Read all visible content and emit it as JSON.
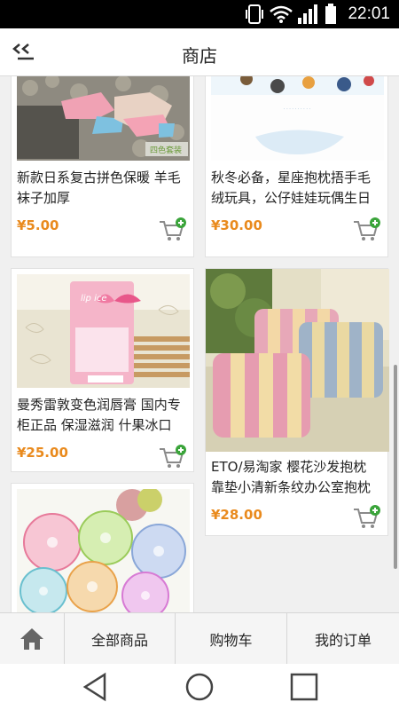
{
  "status_bar": {
    "time": "22:01"
  },
  "header": {
    "title": "商店",
    "back_icon": "back-arrow-icon"
  },
  "products": [
    {
      "title_line1": "新款日系复古拼色保暖 羊毛",
      "title_line2": "袜子加厚",
      "price": "¥5.00",
      "image_badge": "四色套装"
    },
    {
      "title_line1": "秋冬必备，星座抱枕捂手毛",
      "title_line2": "绒玩具，公仔娃娃玩偶生日",
      "price": "¥30.00"
    },
    {
      "title_line1": "曼秀雷敦变色润唇膏 国内专",
      "title_line2": "柜正品 保湿滋润 什果冰口",
      "price": "¥25.00",
      "image_brand": "lip ice"
    },
    {
      "title_line1": "ETO/易淘家 樱花沙发抱枕",
      "title_line2": "靠垫小清新条纹办公室抱枕",
      "price": "¥28.00"
    },
    {
      "title_line1": "",
      "title_line2": "",
      "price": ""
    }
  ],
  "bottom_nav": {
    "home_icon": "home-icon",
    "all_products": "全部商品",
    "cart": "购物车",
    "my_orders": "我的订单"
  },
  "colors": {
    "price": "#e98a1d",
    "cart_plus": "#3aa43a"
  }
}
